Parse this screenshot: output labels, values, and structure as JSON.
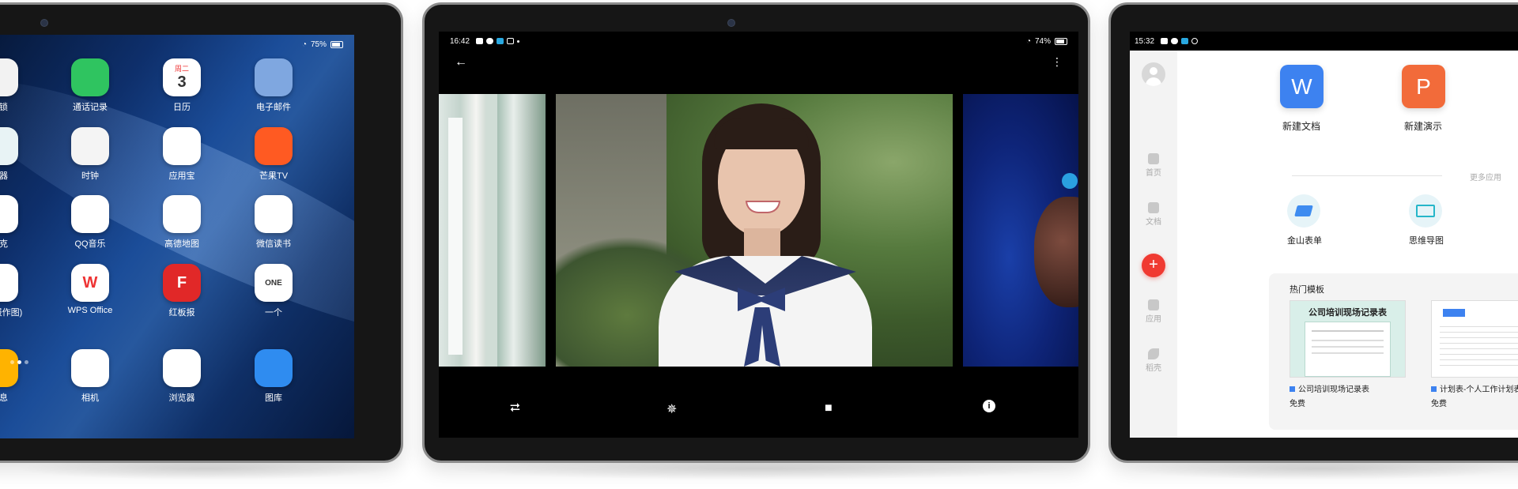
{
  "home": {
    "status": {
      "battery": "75%"
    },
    "apps": [
      {
        "label": "用锁",
        "icon": "lock-icon",
        "color": "#f2f2f2"
      },
      {
        "label": "通话记录",
        "icon": "phone-icon",
        "color": "#2fc460"
      },
      {
        "label": "日历",
        "icon": "calendar-icon",
        "color": "#ffffff",
        "text_top": "周二",
        "text": "3"
      },
      {
        "label": "电子邮件",
        "icon": "mail-icon",
        "color": "#7fa7e0"
      },
      {
        "label": "算器",
        "icon": "calculator-icon",
        "color": "#e8f3f5"
      },
      {
        "label": "时钟",
        "icon": "clock-icon",
        "color": "#f4f4f4"
      },
      {
        "label": "应用宝",
        "icon": "appstore-icon",
        "color": "#ffffff"
      },
      {
        "label": "芒果TV",
        "icon": "mango-tv-icon",
        "color": "#ff5a22"
      },
      {
        "label": "夸克",
        "icon": "quark-icon",
        "color": "#ffffff"
      },
      {
        "label": "QQ音乐",
        "icon": "qq-music-icon",
        "color": "#ffffff"
      },
      {
        "label": "高德地图",
        "icon": "amap-icon",
        "color": "#ffffff"
      },
      {
        "label": "微信读书",
        "icon": "wechat-read-icon",
        "color": "#ffffff"
      },
      {
        "label": "E(海报作图)",
        "icon": "poster-icon",
        "color": "#ffffff"
      },
      {
        "label": "WPS Office",
        "icon": "wps-icon",
        "color": "#ffffff",
        "text": "W"
      },
      {
        "label": "红板报",
        "icon": "flipboard-icon",
        "color": "#e12828",
        "text": "F"
      },
      {
        "label": "一个",
        "icon": "one-icon",
        "color": "#ffffff",
        "text": "ONE"
      },
      {
        "label": "信息",
        "icon": "message-icon",
        "color": "#ffb300"
      },
      {
        "label": "相机",
        "icon": "camera-icon",
        "color": "#ffffff"
      },
      {
        "label": "浏览器",
        "icon": "browser-icon",
        "color": "#ffffff"
      },
      {
        "label": "图库",
        "icon": "gallery-icon",
        "color": "#2f8cf0"
      }
    ]
  },
  "gallery": {
    "status": {
      "time": "16:42",
      "battery": "74%"
    },
    "toolbar": [
      "share-icon",
      "edit-effects-icon",
      "delete-icon",
      "info-icon"
    ]
  },
  "wps": {
    "status": {
      "time": "15:32"
    },
    "rail": [
      "首页",
      "文档",
      "应用",
      "稻壳"
    ],
    "new_doc": "新建文档",
    "new_slides": "新建演示",
    "more_apps": "更多应用",
    "sheet_app": "金山表单",
    "mindmap_app": "思维导图",
    "templates_title": "热门模板",
    "templates": [
      {
        "thumb_title": "公司培训现场记录表",
        "name": "公司培训现场记录表",
        "price": "免费"
      },
      {
        "name": "计划表-个人工作计划表",
        "price": "免费"
      }
    ],
    "colors": {
      "doc": "#3d82f0",
      "slides": "#f26b3a",
      "add": "#f03a32"
    }
  }
}
